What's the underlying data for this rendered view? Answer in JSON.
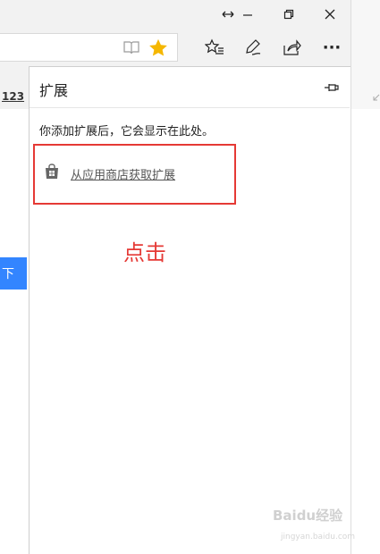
{
  "window": {
    "resize_icon": "double-arrow-icon",
    "minimize_icon": "minimize-icon",
    "restore_icon": "restore-icon",
    "close_icon": "close-icon"
  },
  "toolbar": {
    "reading_view_icon": "book-icon",
    "favorite_star_icon": "star-icon",
    "favorite_star_color": "#f5b700",
    "favorites_hub_icon": "favorites-list-icon",
    "notes_icon": "pen-icon",
    "share_icon": "share-icon",
    "more_label": "···"
  },
  "page": {
    "link_text": "123",
    "blue_button_text": "下",
    "blue_color": "#3385ff"
  },
  "extensions_panel": {
    "title": "扩展",
    "pin_icon": "pin-icon",
    "empty_message": "你添加扩展后，它会显示在此处。",
    "store_icon": "store-bag-icon",
    "store_link_label": "从应用商店获取扩展"
  },
  "annotation": {
    "click_text": "点击",
    "highlight_color": "#e53935"
  },
  "watermark": {
    "text": "Baidu经验",
    "subtext": "jingyan.baidu.com"
  }
}
